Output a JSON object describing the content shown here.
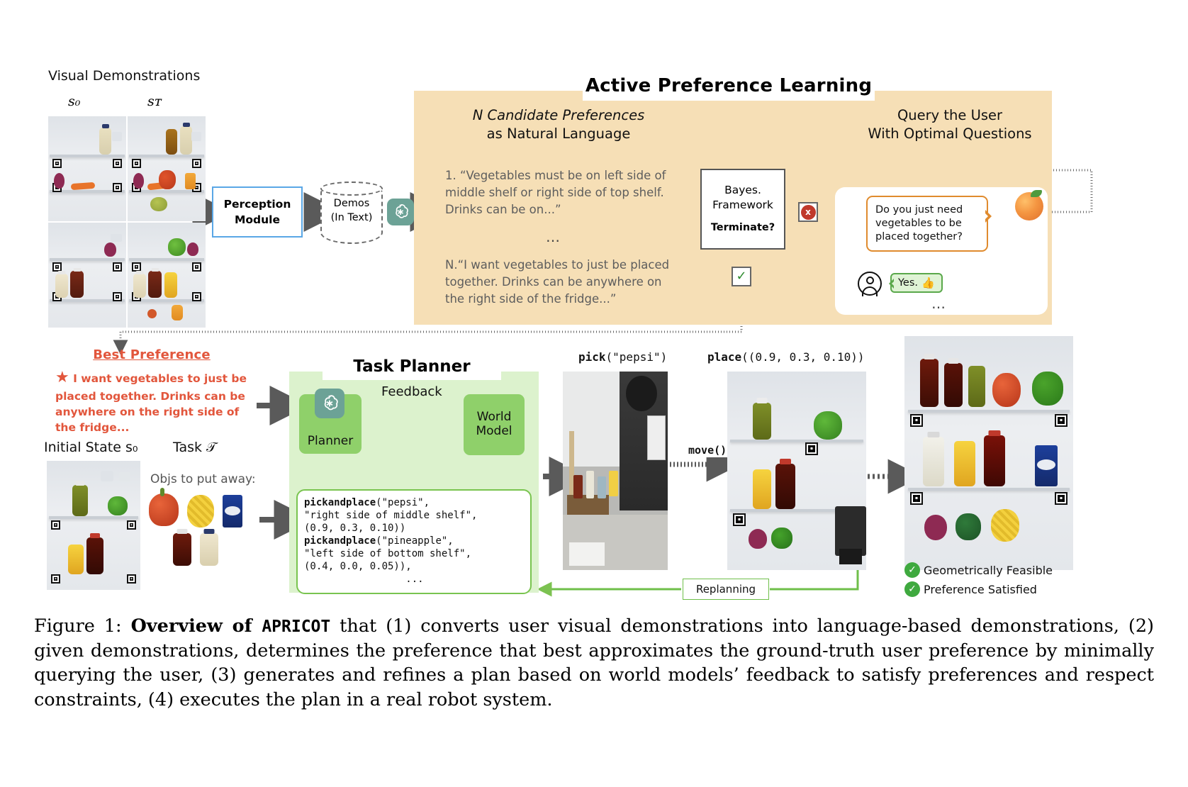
{
  "figure": {
    "caption_prefix": "Figure 1: ",
    "caption_bold": "Overview of ",
    "caption_mono": "APRICOT",
    "caption_rest": " that (1) converts user visual demonstrations into language-based demonstrations, (2) given demonstrations, determines the preference that best approximates the ground-truth user preference by minimally querying the user, (3) generates and refines a plan based on world models’ feedback to satisfy preferences and respect constraints, (4) executes the plan in a real robot system."
  },
  "demos": {
    "title": "Visual Demonstrations",
    "col_initial": "s₀",
    "col_final": "sᴛ"
  },
  "pipeline": {
    "perception_line1": "Perception",
    "perception_line2": "Module",
    "demos_line1": "Demos",
    "demos_line2": "(In Text)"
  },
  "apl": {
    "title": "Active Preference Learning",
    "left_heading_line1": "N Candidate Preferences",
    "left_heading_line2": "as Natural Language",
    "right_heading_line1": "Query the User",
    "right_heading_line2": "With Optimal Questions",
    "pref_1": "1. “Vegetables must be on left side of middle shelf or right side of top shelf. Drinks can be on...”",
    "ellipsis": "…",
    "pref_n": "N.“I want vegetables to just be placed together. Drinks can be anywhere on the right side of the fridge...”",
    "bayes_line1": "Bayes.",
    "bayes_line2": "Framework",
    "terminate": "Terminate?",
    "x_mark": "x",
    "check_mark": "✓",
    "question": "Do you just need vegetables to be placed together?",
    "user_answer": "Yes.",
    "thumb_icon": "👍",
    "chat_ellipsis": "…"
  },
  "best_preference": {
    "heading": "Best Preference",
    "text": "I want vegetables to just be placed together. Drinks can be anywhere on the right side of the fridge..."
  },
  "task": {
    "initial_state_label": "Initial State s₀",
    "task_label": "Task 𝒯",
    "objs_label": "Objs to put away:"
  },
  "planner": {
    "title": "Task Planner",
    "planner_label": "Planner",
    "world_model_line1": "World",
    "world_model_line2": "Model",
    "feedback_label": "Feedback",
    "code_lines": [
      {
        "fn": "pickandplace",
        "rest": "(\"pepsi\","
      },
      {
        "fn": "",
        "rest": "\"right side of middle shelf\","
      },
      {
        "fn": "",
        "rest": "(0.9, 0.3, 0.10))"
      },
      {
        "fn": "pickandplace",
        "rest": "(\"pineapple\","
      },
      {
        "fn": "",
        "rest": "\"left side of bottom shelf\","
      },
      {
        "fn": "",
        "rest": "(0.4, 0.0, 0.05)),"
      },
      {
        "fn": "",
        "rest": "                 ..."
      }
    ]
  },
  "execution": {
    "pick_label_fn": "pick",
    "pick_label_arg": "(\"pepsi\")",
    "place_label_fn": "place",
    "place_label_arg": "((0.9, 0.3, 0.10))",
    "move_label": "move()",
    "replanning_label": "Replanning",
    "status_geometric": "Geometrically Feasible",
    "status_preference": "Preference Satisfied",
    "status_check": "✓"
  },
  "colors": {
    "apl_panel": "#f6dfb6",
    "planner_panel": "#dcf2cd",
    "planner_node": "#8fd06a",
    "accent_red": "#e2563c",
    "accent_orange": "#e08b2e",
    "accent_green": "#3fa93f",
    "perception_border": "#5aa7e6",
    "gpt_chip": "#6ca296"
  }
}
